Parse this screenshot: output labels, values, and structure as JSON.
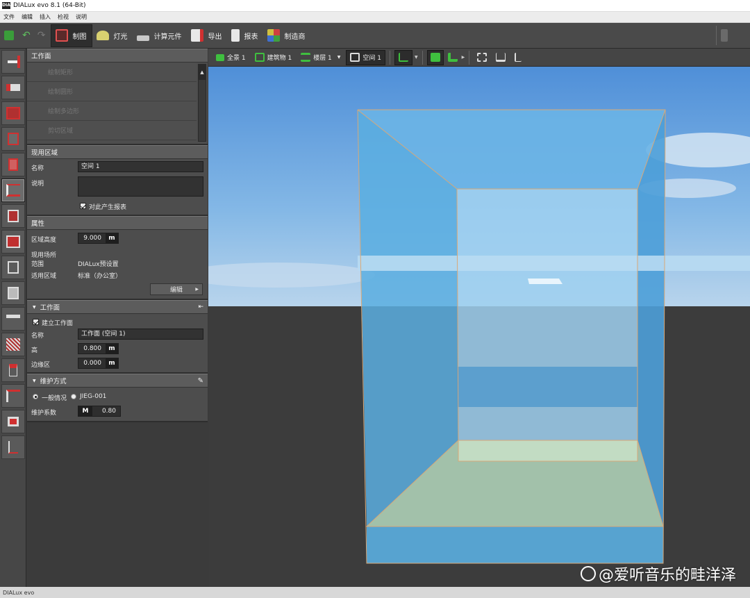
{
  "window": {
    "title": "DIALux evo 8.1  (64-Bit)",
    "logo_text": "DIA"
  },
  "menu": [
    "文件",
    "编辑",
    "插入",
    "检视",
    "说明"
  ],
  "toolbar": {
    "tabs": [
      {
        "label": "制图",
        "active": true
      },
      {
        "label": "灯光",
        "active": false
      },
      {
        "label": "计算元件",
        "active": false
      },
      {
        "label": "导出",
        "active": false
      },
      {
        "label": "报表",
        "active": false
      },
      {
        "label": "制造商",
        "active": false
      }
    ]
  },
  "left_tools": [
    "import-icon",
    "furniture-icon",
    "building-icon",
    "wall-icon",
    "door-icon",
    "room-icon",
    "cube-icon",
    "roof-icon",
    "box-icon",
    "window-icon",
    "table-icon",
    "stairs-icon",
    "drawing-icon",
    "column-icon",
    "frame-icon",
    "grid-icon"
  ],
  "working_plane_tools": {
    "header": "工作面",
    "items": [
      "绘制矩形",
      "绘制圆形",
      "绘制多边形",
      "剪切区域"
    ]
  },
  "use_area": {
    "header": "现用区域",
    "name_label": "名称",
    "name_value": "空间 1",
    "desc_label": "说明",
    "desc_value": "",
    "report_label": "对此产生报表",
    "report_checked": true
  },
  "properties": {
    "header": "属性",
    "height_label": "区域高度",
    "height_value": "9.000",
    "height_unit": "m",
    "use_label": "现用场所",
    "scope_label": "范围",
    "scope_value": "DIALux预设置",
    "area_label": "适用区域",
    "area_value": "标准（办公室）",
    "edit_button": "编辑"
  },
  "workplane": {
    "header": "工作面",
    "create_label": "建立工作面",
    "create_checked": true,
    "name_label": "名称",
    "name_value": "工作面 (空间 1)",
    "height_label": "高",
    "height_value": "0.800",
    "height_unit": "m",
    "margin_label": "边缘区",
    "margin_value": "0.000",
    "margin_unit": "m"
  },
  "maintenance": {
    "header": "维护方式",
    "opt1": "一般情况",
    "opt2": "JIEG-001",
    "factor_label": "维护系数",
    "factor_prefix": "M",
    "factor_value": "0.80"
  },
  "viewbar": {
    "scene": "全景 1",
    "building": "建筑物 1",
    "floor": "楼层 1",
    "room": "空间 1"
  },
  "statusbar": {
    "text": "DIALux evo"
  },
  "watermark": "@爱听音乐的畦洋泽",
  "colors": {
    "accent_green": "#3fbf3f",
    "room_blue": "#5aaee0",
    "sky": "#6ea8e0",
    "ground": "#3c3c3c"
  }
}
